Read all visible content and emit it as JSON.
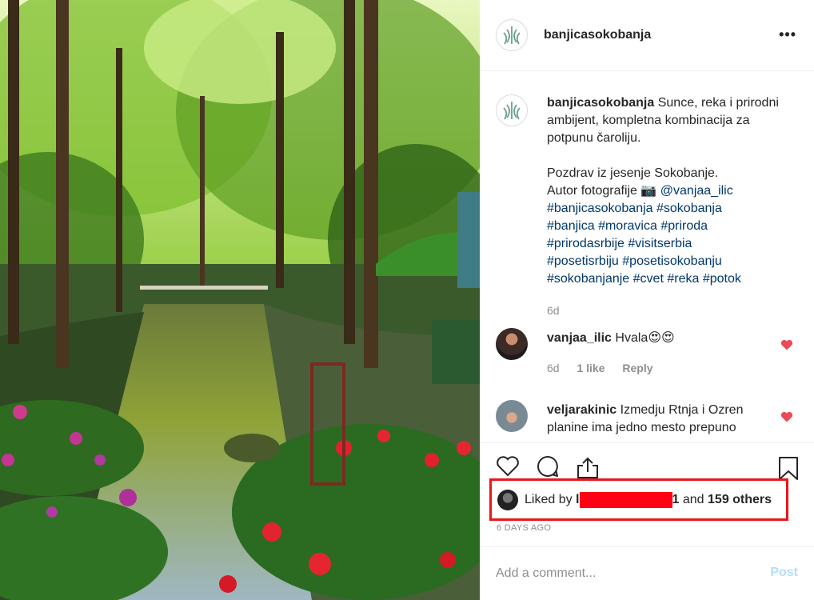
{
  "post": {
    "username": "banjicasokobanja",
    "more_icon": "ellipsis-icon",
    "more_label": "•••"
  },
  "caption": {
    "username": "banjicasokobanja",
    "text1": "Sunce, reka i prirodni ambijent, kompletna kombinacija za potpunu čaroliju.",
    "text2": "Pozdrav iz jesenje Sokobanje.",
    "text3": "Autor fotografije 📷",
    "mention": "@vanjaa_ilic",
    "hashtags": [
      "#banjicasokobanja",
      "#sokobanja",
      "#banjica",
      "#moravica",
      "#priroda",
      "#prirodasrbije",
      "#visitserbia",
      "#posetisrbiju",
      "#posetisokobanju",
      "#sokobanjanje",
      "#cvet",
      "#reka",
      "#potok"
    ],
    "age": "6d"
  },
  "comments": [
    {
      "username": "vanjaa_ilic",
      "text": "Hvala😍😍",
      "age": "6d",
      "likes": "1 like",
      "reply": "Reply"
    },
    {
      "username": "veljarakinic",
      "text": "Izmedju Rtnja i Ozren planine ima jedno mesto prepuno"
    }
  ],
  "likes": {
    "prefix": "Liked by",
    "name_start": "l",
    "name_end": "1",
    "and": "and",
    "others": "159 others"
  },
  "date": "6 DAYS AGO",
  "add_comment": {
    "placeholder": "Add a comment...",
    "post_label": "Post"
  },
  "colors": {
    "link": "#00376b",
    "heart": "#ed4956",
    "highlight": "#e8161c",
    "redaction": "#ff0014"
  }
}
